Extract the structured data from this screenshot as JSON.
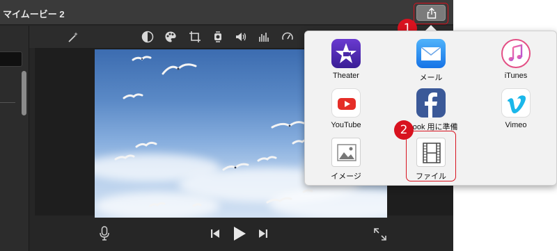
{
  "window": {
    "title": "マイムービー 2"
  },
  "toolbar": {
    "icons": [
      "magic-wand-icon",
      "color-balance-icon",
      "palette-icon",
      "crop-icon",
      "stabilization-icon",
      "volume-icon",
      "equalizer-icon",
      "speed-icon"
    ]
  },
  "viewer": {
    "content": "seagulls-over-sky-video-frame"
  },
  "playback": {
    "icons": [
      "microphone-icon",
      "skip-back-icon",
      "play-icon",
      "skip-forward-icon",
      "fullscreen-icon"
    ]
  },
  "share_menu": {
    "items": [
      {
        "label": "Theater",
        "icon": "theater-star-icon",
        "color": "#4a2aa8"
      },
      {
        "label": "メール",
        "icon": "mail-envelope-icon",
        "color": "#1f8ef1"
      },
      {
        "label": "iTunes",
        "icon": "itunes-note-icon",
        "color": "#e8356e"
      },
      {
        "label": "YouTube",
        "icon": "youtube-icon",
        "color": "#e52d27"
      },
      {
        "label": "ebook 用に準備",
        "icon": "facebook-icon",
        "color": "#3b5998"
      },
      {
        "label": "Vimeo",
        "icon": "vimeo-icon",
        "color": "#1ab7ea"
      },
      {
        "label": "イメージ",
        "icon": "image-icon",
        "color": "#8a8a8a"
      },
      {
        "label": "ファイル",
        "icon": "film-file-icon",
        "color": "#555555"
      }
    ]
  },
  "annotations": {
    "step1": "1",
    "step2": "2",
    "highlight_color": "#d8121f"
  }
}
